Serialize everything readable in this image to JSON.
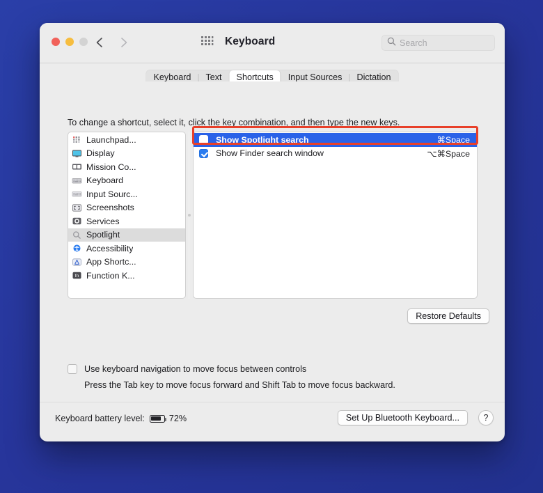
{
  "window": {
    "title": "Keyboard",
    "traffic_lights": [
      "close",
      "minimize",
      "zoom"
    ],
    "back_label": "Back",
    "forward_label": "Forward",
    "show_all_label": "Show All"
  },
  "search": {
    "placeholder": "Search",
    "value": "",
    "icon": "search-icon"
  },
  "tabs": [
    {
      "label": "Keyboard",
      "active": false
    },
    {
      "label": "Text",
      "active": false
    },
    {
      "label": "Shortcuts",
      "active": true
    },
    {
      "label": "Input Sources",
      "active": false
    },
    {
      "label": "Dictation",
      "active": false
    }
  ],
  "main": {
    "instructions": "To change a shortcut, select it, click the key combination, and then type the new keys.",
    "restore_defaults_label": "Restore Defaults"
  },
  "categories": [
    {
      "label": "Launchpad...",
      "icon": "launchpad-icon",
      "selected": false
    },
    {
      "label": "Display",
      "icon": "display-icon",
      "selected": false
    },
    {
      "label": "Mission Co...",
      "icon": "mission-control-icon",
      "selected": false
    },
    {
      "label": "Keyboard",
      "icon": "keyboard-icon",
      "selected": false
    },
    {
      "label": "Input Sourc...",
      "icon": "input-sources-icon",
      "selected": false
    },
    {
      "label": "Screenshots",
      "icon": "screenshots-icon",
      "selected": false
    },
    {
      "label": "Services",
      "icon": "services-gear-icon",
      "selected": false
    },
    {
      "label": "Spotlight",
      "icon": "spotlight-magnifier-icon",
      "selected": true
    },
    {
      "label": "Accessibility",
      "icon": "accessibility-icon",
      "selected": false
    },
    {
      "label": "App Shortc...",
      "icon": "app-shortcuts-icon",
      "selected": false
    },
    {
      "label": "Function K...",
      "icon": "function-keys-fn-icon",
      "selected": false
    }
  ],
  "shortcuts": [
    {
      "name": "Show Spotlight search",
      "combo": "⌘Space",
      "checked": false,
      "selected": true
    },
    {
      "name": "Show Finder search window",
      "combo": "⌥⌘Space",
      "checked": true,
      "selected": false
    }
  ],
  "keyboard_nav": {
    "checkbox_label": "Use keyboard navigation to move focus between controls",
    "checked": false,
    "hint": "Press the Tab key to move focus forward and Shift Tab to move focus backward."
  },
  "bottom": {
    "battery_label": "Keyboard battery level:",
    "battery_percent": "72%",
    "bluetooth_button_label": "Set Up Bluetooth Keyboard...",
    "help_label": "?"
  },
  "annotation": {
    "color": "#e8402a",
    "target": "Show Spotlight search"
  }
}
